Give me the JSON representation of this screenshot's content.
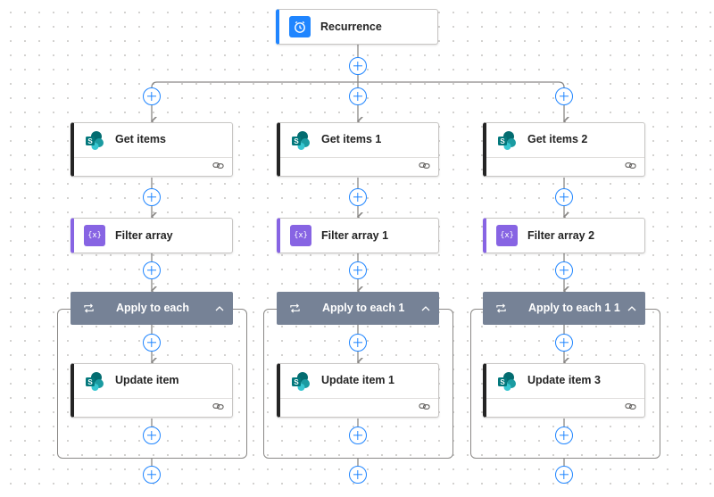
{
  "trigger": {
    "title": "Recurrence",
    "icon": "alarm-clock-icon",
    "color": "#1f85ff"
  },
  "branches": [
    {
      "get_items": "Get items",
      "filter": "Filter array",
      "loop": "Apply to each",
      "update": "Update item"
    },
    {
      "get_items": "Get items 1",
      "filter": "Filter array 1",
      "loop": "Apply to each 1",
      "update": "Update item 1"
    },
    {
      "get_items": "Get items 2",
      "filter": "Filter array 2",
      "loop": "Apply to each 1 1",
      "update": "Update item 3"
    }
  ],
  "colors": {
    "accent": "#1f85ff",
    "filter": "#8764e3",
    "loop_header": "#768296",
    "sharepoint": "#038387",
    "connector": "#8a8886"
  },
  "icons": {
    "sharepoint": "sharepoint-icon",
    "filter": "variable-braces-icon",
    "loop": "loop-icon",
    "collapse": "chevron-up-icon",
    "link": "link-icon",
    "add": "plus-icon"
  },
  "filter_icon_glyph": "{x}"
}
